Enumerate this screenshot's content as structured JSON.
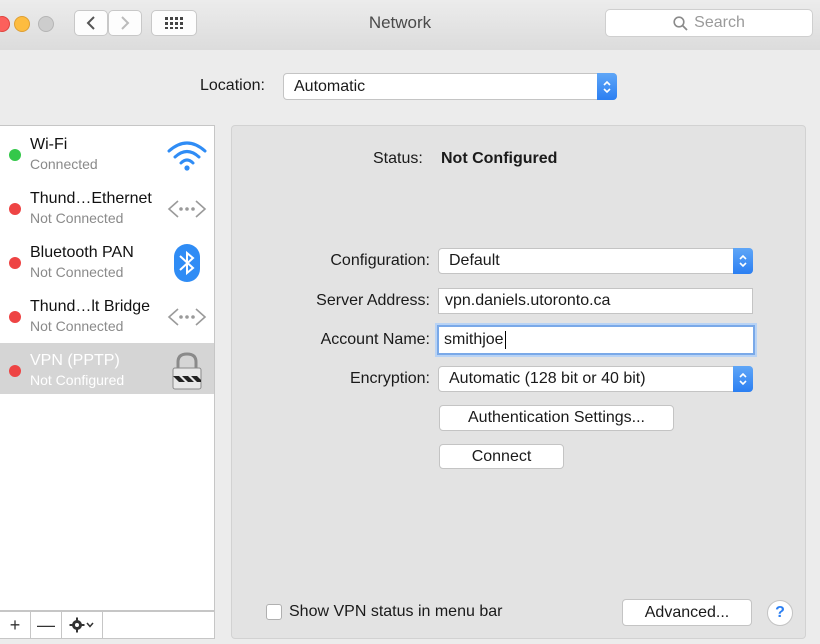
{
  "window": {
    "title": "Network"
  },
  "toolbar": {
    "search_placeholder": "Search"
  },
  "location": {
    "label": "Location:",
    "value": "Automatic"
  },
  "services": [
    {
      "name": "Wi-Fi",
      "status": "Connected",
      "status_color": "#34c84a"
    },
    {
      "name": "Thund…Ethernet",
      "status": "Not Connected",
      "status_color": "#ee4444"
    },
    {
      "name": "Bluetooth PAN",
      "status": "Not Connected",
      "status_color": "#ee4444"
    },
    {
      "name": "Thund…lt Bridge",
      "status": "Not Connected",
      "status_color": "#ee4444"
    },
    {
      "name": "VPN (PPTP)",
      "status": "Not Configured",
      "status_color": "#ee4444",
      "selected": true
    }
  ],
  "sidebar_tools": {
    "add": "+",
    "remove": "—"
  },
  "detail": {
    "status_label": "Status:",
    "status_value": "Not Configured",
    "configuration_label": "Configuration:",
    "configuration_value": "Default",
    "server_label": "Server Address:",
    "server_value": "vpn.daniels.utoronto.ca",
    "account_label": "Account Name:",
    "account_value": "smithjoe",
    "encryption_label": "Encryption:",
    "encryption_value": "Automatic (128 bit or 40 bit)",
    "auth_button": "Authentication Settings...",
    "connect_button": "Connect",
    "show_status_label": "Show VPN status in menu bar",
    "advanced_button": "Advanced...",
    "help_label": "?"
  },
  "colors": {
    "accent": "#2b7ff2",
    "selected_row": "#d5d5d5"
  }
}
